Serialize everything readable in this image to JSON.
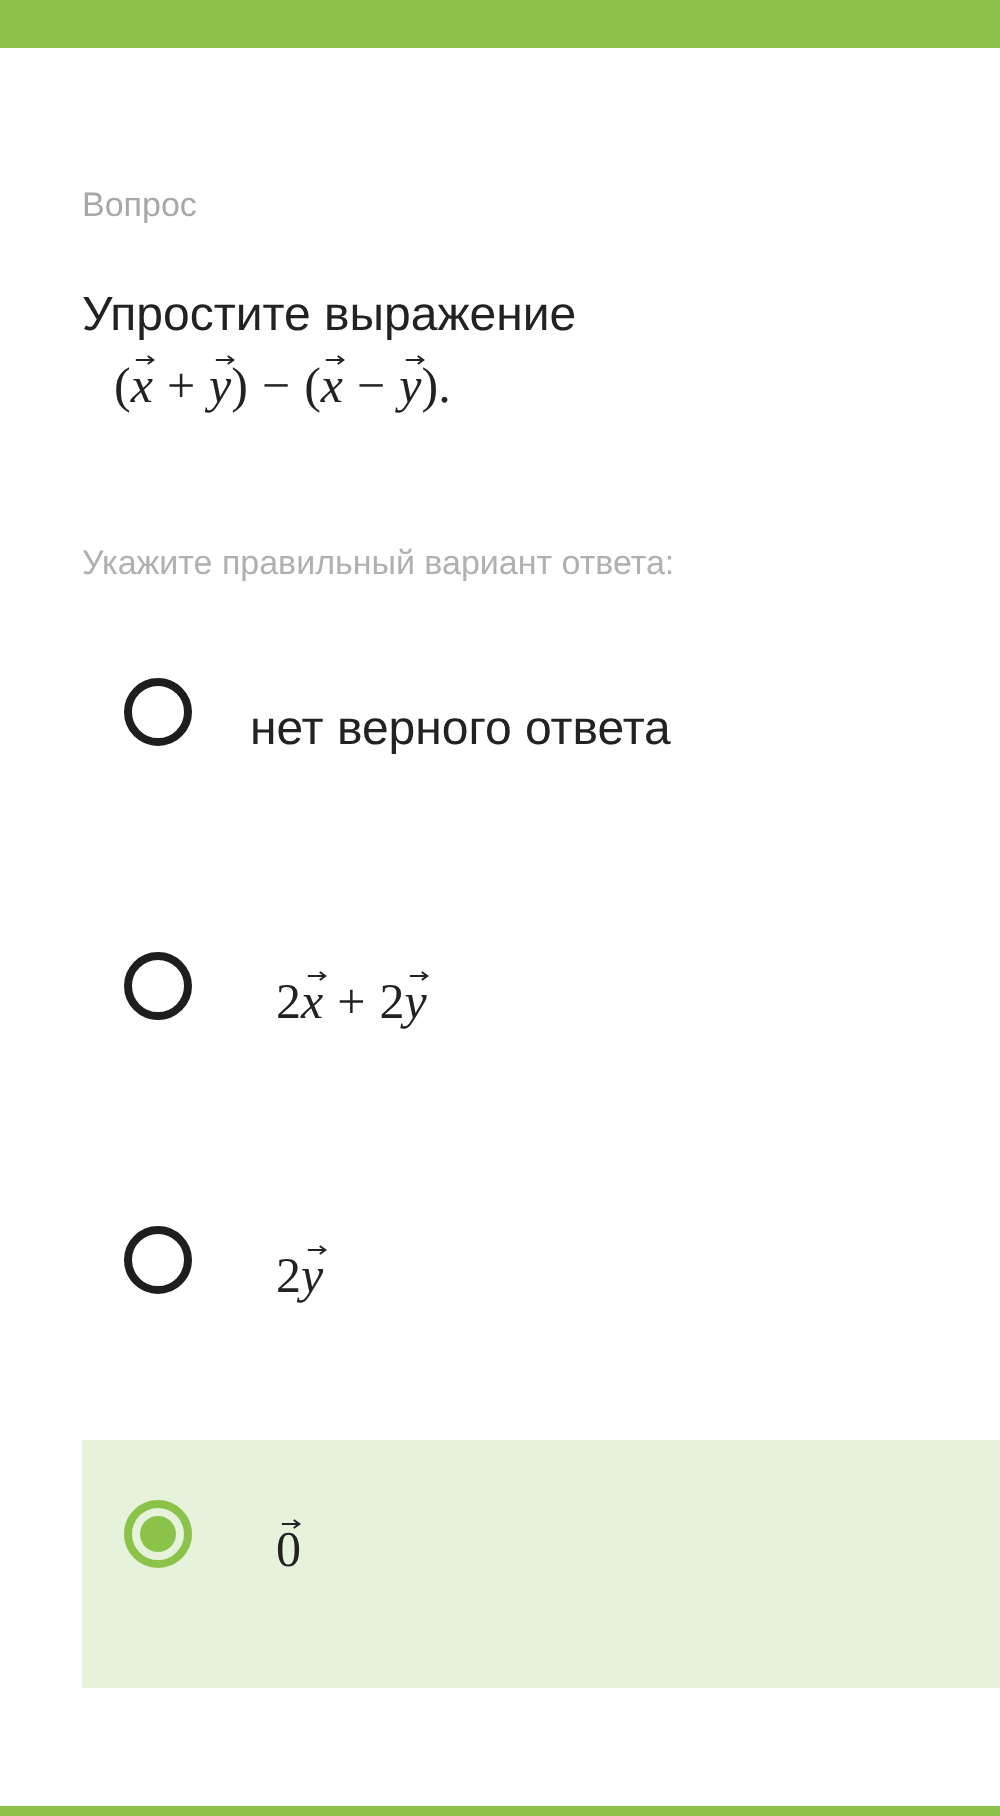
{
  "header_label": "Вопрос",
  "question": {
    "text": "Упростите выражение",
    "formula": [
      {
        "kind": "plain",
        "text": "("
      },
      {
        "kind": "var_vector",
        "text": "x"
      },
      {
        "kind": "op",
        "text": "+"
      },
      {
        "kind": "var_vector",
        "text": "y"
      },
      {
        "kind": "plain",
        "text": ")"
      },
      {
        "kind": "op",
        "text": "−"
      },
      {
        "kind": "plain",
        "text": "("
      },
      {
        "kind": "var_vector",
        "text": "x"
      },
      {
        "kind": "op",
        "text": "−"
      },
      {
        "kind": "var_vector",
        "text": "y"
      },
      {
        "kind": "plain",
        "text": ")."
      }
    ]
  },
  "instruction": "Укажите правильный вариант ответа:",
  "options": [
    {
      "kind": "text",
      "label": "нет верного ответа",
      "selected": false
    },
    {
      "kind": "math",
      "formula": [
        {
          "kind": "plain",
          "text": "2"
        },
        {
          "kind": "var_vector",
          "text": "x"
        },
        {
          "kind": "op",
          "text": "+"
        },
        {
          "kind": "plain",
          "text": "2"
        },
        {
          "kind": "var_vector",
          "text": "y"
        }
      ],
      "selected": false
    },
    {
      "kind": "math",
      "formula": [
        {
          "kind": "plain",
          "text": "2"
        },
        {
          "kind": "var_vector",
          "text": "y"
        }
      ],
      "selected": false
    },
    {
      "kind": "math",
      "formula": [
        {
          "kind": "num_vector",
          "text": "0"
        }
      ],
      "selected": true
    }
  ]
}
